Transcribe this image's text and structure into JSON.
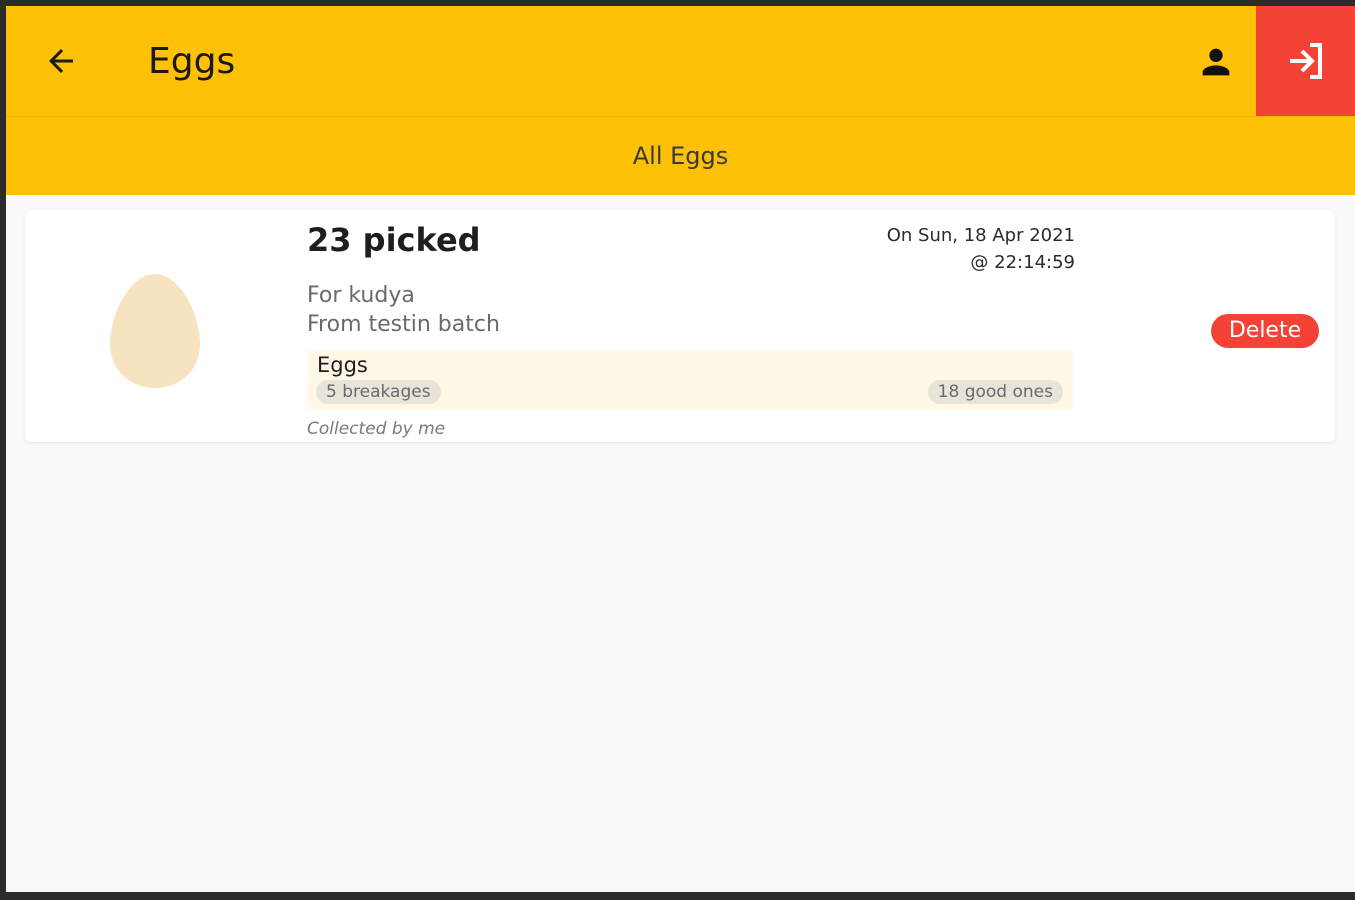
{
  "appbar": {
    "title": "Eggs",
    "back_icon": "arrow-left-icon",
    "account_icon": "person-icon",
    "logout_icon": "login-arrow-icon",
    "background": "#ffc107",
    "logout_background": "#f44336"
  },
  "tabs": [
    {
      "label": "All Eggs",
      "active": true
    }
  ],
  "records": [
    {
      "picked": "23 picked",
      "date_line1": "On Sun, 18 Apr 2021",
      "date_line2": "@ 22:14:59",
      "for_line": "For kudya",
      "from_line": "From testin batch",
      "box_title": "Eggs",
      "breakages": "5 breakages",
      "good": "18 good ones",
      "collected_by": "Collected by me",
      "delete_label": "Delete",
      "icon": "egg-icon",
      "egg_color": "#f8e3c0"
    }
  ]
}
